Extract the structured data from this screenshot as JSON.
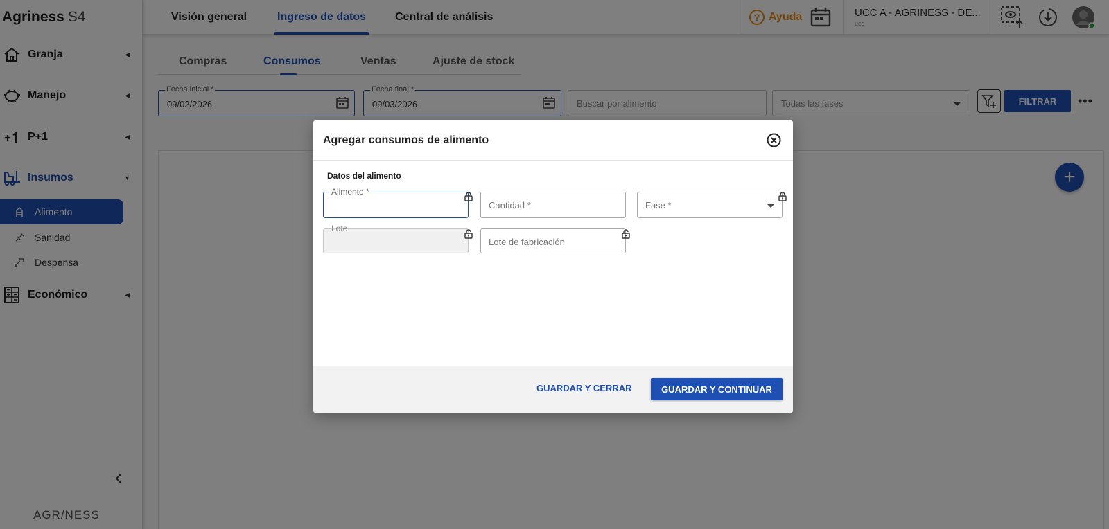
{
  "app": {
    "brand_name": "Agriness",
    "brand_suffix": "S4",
    "footer_logo": "AGR/NESS"
  },
  "top_tabs": [
    {
      "label": "Visión general"
    },
    {
      "label": "Ingreso de datos"
    },
    {
      "label": "Central de análisis"
    }
  ],
  "header": {
    "help_label": "Ayuda",
    "farm_name": "UCC A - AGRINESS - DE...",
    "farm_sub": "ucc"
  },
  "sidebar": {
    "items": [
      {
        "label": "Granja"
      },
      {
        "label": "Manejo"
      },
      {
        "label": "P+1"
      },
      {
        "label": "Insumos"
      },
      {
        "label": "Económico"
      }
    ],
    "sub_items": [
      {
        "label": "Alimento"
      },
      {
        "label": "Sanidad"
      },
      {
        "label": "Despensa"
      }
    ]
  },
  "sub_tabs": [
    {
      "label": "Compras"
    },
    {
      "label": "Consumos"
    },
    {
      "label": "Ventas"
    },
    {
      "label": "Ajuste de stock"
    }
  ],
  "filters": {
    "start_date_label": "Fecha inicial *",
    "start_date_value": "09/02/2026",
    "end_date_label": "Fecha final *",
    "end_date_value": "09/03/2026",
    "search_placeholder": "Buscar por alimento",
    "phases_value": "Todas las fases",
    "filter_button": "FILTRAR"
  },
  "modal": {
    "title": "Agregar consumos de alimento",
    "section_title": "Datos del alimento",
    "fields": {
      "alimento_label": "Alimento *",
      "cantidad_placeholder": "Cantidad *",
      "fase_placeholder": "Fase *",
      "lote_label": "Lote",
      "lote_fabricacion_placeholder": "Lote de fabricación"
    },
    "buttons": {
      "save_close": "GUARDAR Y CERRAR",
      "save_continue": "GUARDAR Y CONTINUAR"
    }
  },
  "colors": {
    "primary": "#1e4fb3",
    "help": "#e88b12",
    "online": "#2e9e44"
  }
}
